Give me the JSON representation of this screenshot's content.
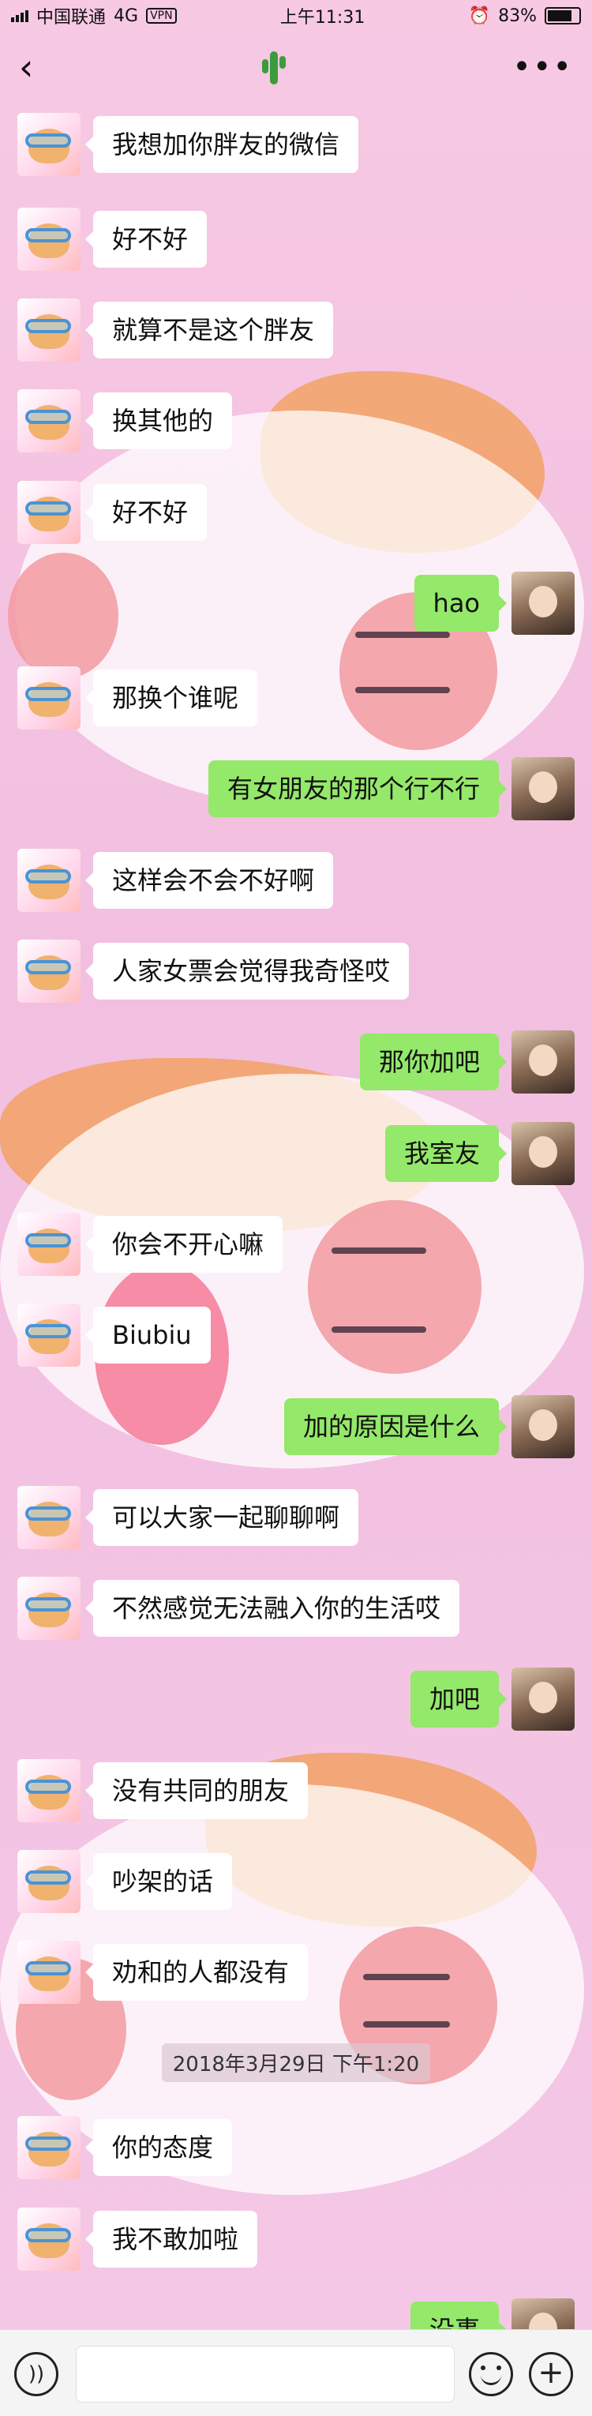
{
  "status_bar": {
    "carrier": "中国联通",
    "network": "4G",
    "vpn": "VPN",
    "time": "上午11:31",
    "battery": "83%"
  },
  "nav": {
    "back_icon": "chevron-left-icon",
    "title_icon": "cactus-icon",
    "more_icon": "more-icon",
    "back_label": "‹",
    "more_label": "•••"
  },
  "messages": [
    {
      "side": "left",
      "text": "我想加你胖友的微信"
    },
    {
      "side": "left",
      "text": "好不好"
    },
    {
      "side": "left",
      "text": "就算不是这个胖友"
    },
    {
      "side": "left",
      "text": "换其他的"
    },
    {
      "side": "left",
      "text": "好不好"
    },
    {
      "side": "right",
      "text": "hao"
    },
    {
      "side": "left",
      "text": "那换个谁呢"
    },
    {
      "side": "right",
      "text": "有女朋友的那个行不行"
    },
    {
      "side": "left",
      "text": "这样会不会不好啊"
    },
    {
      "side": "left",
      "text": "人家女票会觉得我奇怪哎"
    },
    {
      "side": "right",
      "text": "那你加吧"
    },
    {
      "side": "right",
      "text": "我室友"
    },
    {
      "side": "left",
      "text": "你会不开心嘛"
    },
    {
      "side": "left",
      "text": "Biubiu"
    },
    {
      "side": "right",
      "text": "加的原因是什么"
    },
    {
      "side": "left",
      "text": "可以大家一起聊聊啊"
    },
    {
      "side": "left",
      "text": "不然感觉无法融入你的生活哎"
    },
    {
      "side": "right",
      "text": "加吧"
    },
    {
      "side": "left",
      "text": "没有共同的朋友"
    },
    {
      "side": "left",
      "text": "吵架的话"
    },
    {
      "side": "left",
      "text": "劝和的人都没有"
    },
    {
      "side": "left",
      "text": "你的态度"
    },
    {
      "side": "left",
      "text": "我不敢加啦"
    },
    {
      "side": "right",
      "text": "没事"
    }
  ],
  "timestamp": "2018年3月29日 下午1:20",
  "input_bar": {
    "voice_icon": "voice-icon",
    "emoji_icon": "emoji-icon",
    "plus_icon": "plus-icon",
    "plus_label": "+",
    "voice_label": "))"
  }
}
